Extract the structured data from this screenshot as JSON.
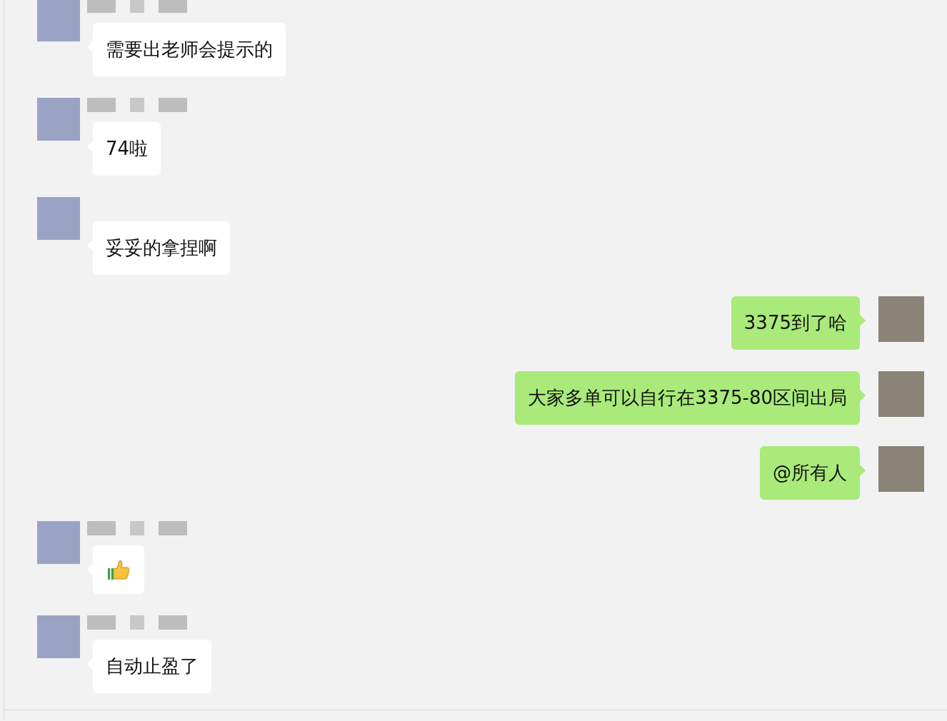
{
  "messages": [
    {
      "kind": "received",
      "show_name": true,
      "text": "需要出老师会提示的"
    },
    {
      "kind": "received",
      "show_name": true,
      "text": "74啦"
    },
    {
      "kind": "received",
      "show_name": false,
      "text": "妥妥的拿捏啊"
    },
    {
      "kind": "sent",
      "text": "3375到了哈"
    },
    {
      "kind": "sent",
      "text": "大家多单可以自行在3375-80区间出局"
    },
    {
      "kind": "sent",
      "text": "@所有人"
    },
    {
      "kind": "received-emoji",
      "show_name": true
    },
    {
      "kind": "received",
      "show_name": true,
      "text": "自动止盈了"
    }
  ]
}
